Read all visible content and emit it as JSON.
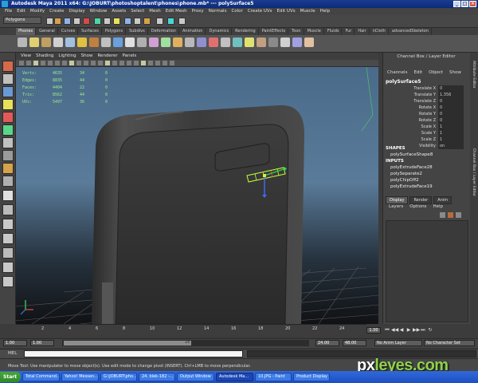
{
  "window": {
    "title": "Autodesk Maya 2011 x64: G:\\JOBURT\\photoshoptalent\\phones\\phone.mb* --- polySurface5"
  },
  "menubar": [
    "File",
    "Edit",
    "Modify",
    "Create",
    "Display",
    "Window",
    "Assets",
    "Select",
    "Mesh",
    "Edit Mesh",
    "Proxy",
    "Normals",
    "Color",
    "Create UVs",
    "Edit UVs",
    "Muscle",
    "Help"
  ],
  "statusline": {
    "mode": "Polygons"
  },
  "shelf": {
    "tabs": [
      "Phones",
      "General",
      "Curves",
      "Surfaces",
      "Polygons",
      "Subdivs",
      "Deformation",
      "Animation",
      "Dynamics",
      "Rendering",
      "PaintEffects",
      "Toon",
      "Muscle",
      "Fluids",
      "Fur",
      "Hair",
      "nCloth",
      "advancedSkeleton"
    ],
    "active_tab": "Phones"
  },
  "viewport": {
    "menu": [
      "View",
      "Shading",
      "Lighting",
      "Show",
      "Renderer",
      "Panels"
    ],
    "hud": [
      {
        "label": "Verts:",
        "a": "4635",
        "b": "34",
        "c": "0"
      },
      {
        "label": "Edges:",
        "a": "8835",
        "b": "44",
        "c": "0"
      },
      {
        "label": "Faces:",
        "a": "4404",
        "b": "22",
        "c": "0"
      },
      {
        "label": "Tris:",
        "a": "8562",
        "b": "44",
        "c": "0"
      },
      {
        "label": "UVs:",
        "a": "5497",
        "b": "36",
        "c": "0"
      }
    ],
    "camera": "persp"
  },
  "channelbox": {
    "title": "Channel Box / Layer Editor",
    "menu": [
      "Channels",
      "Edit",
      "Object",
      "Show"
    ],
    "object": "polySurface5",
    "attributes": [
      {
        "name": "Translate X",
        "value": "0"
      },
      {
        "name": "Translate Y",
        "value": "1.356"
      },
      {
        "name": "Translate Z",
        "value": "0"
      },
      {
        "name": "Rotate X",
        "value": "0"
      },
      {
        "name": "Rotate Y",
        "value": "0"
      },
      {
        "name": "Rotate Z",
        "value": "0"
      },
      {
        "name": "Scale X",
        "value": "1"
      },
      {
        "name": "Scale Y",
        "value": "1"
      },
      {
        "name": "Scale Z",
        "value": "1"
      },
      {
        "name": "Visibility",
        "value": "on"
      }
    ],
    "shapes_label": "SHAPES",
    "shape": "polySurfaceShape8",
    "inputs_label": "INPUTS",
    "inputs": [
      "polyExtrudeFace28",
      "polySeparate2",
      "polyChipOff2",
      "polyExtrudeFace19"
    ]
  },
  "sidebar_tabs": [
    "Attribute Editor",
    "Channel Box / Layer Editor"
  ],
  "layers": {
    "tabs": [
      "Display",
      "Render",
      "Anim"
    ],
    "active_tab": "Display",
    "menu": [
      "Layers",
      "Options",
      "Help"
    ]
  },
  "timeslider": {
    "ticks": [
      "2",
      "4",
      "6",
      "8",
      "10",
      "12",
      "14",
      "16",
      "18",
      "20",
      "22",
      "24"
    ],
    "current": "1.00"
  },
  "range": {
    "start": "1.00",
    "inner_start": "1.00",
    "knob_label": "24",
    "end": "24.00",
    "outer_end": "48.00",
    "anim_layer": "No Anim Layer",
    "character_set": "No Character Set"
  },
  "cmdline": {
    "label": "MEL"
  },
  "helpline": "Move Tool: Use manipulator to move object(s). Use edit mode to change pivot (INSERT). Ctrl+LMB to move perpendicular.",
  "taskbar": {
    "start": "Start",
    "tasks": [
      {
        "label": "Total Command...",
        "active": false
      },
      {
        "label": "Yahoo! Messen...",
        "active": false
      },
      {
        "label": "G:\\JOBURT\\pho...",
        "active": false
      },
      {
        "label": "24. blek-182 -...",
        "active": false
      },
      {
        "label": "Output Window",
        "active": false
      },
      {
        "label": "Autodesk Ma...",
        "active": true
      },
      {
        "label": "10.JPG - Paint",
        "active": false
      },
      {
        "label": "Product Display ...",
        "active": false
      }
    ]
  },
  "watermark": {
    "text_a": "px",
    "text_b": "leyes.com"
  },
  "colors": {
    "title_bar": "#0c2a7a",
    "hud_text": "#9af08a",
    "taskbar": "#1d4fc2",
    "viewport_top": "#4f6f8f"
  }
}
